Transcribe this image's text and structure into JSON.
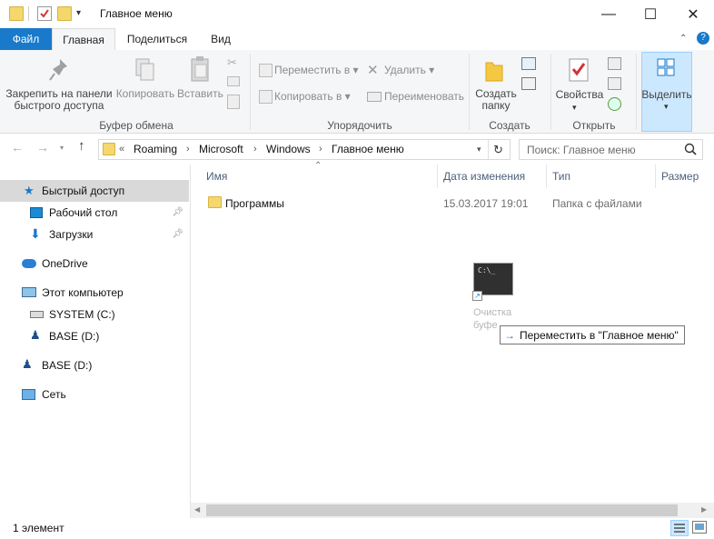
{
  "window": {
    "title": "Главное меню",
    "minimize_glyph": "—",
    "maximize_glyph": "☐",
    "close_glyph": "✕"
  },
  "tabs": [
    {
      "label": "Файл"
    },
    {
      "label": "Главная"
    },
    {
      "label": "Поделиться"
    },
    {
      "label": "Вид"
    }
  ],
  "ribbon": {
    "pin_label_1": "Закрепить на панели",
    "pin_label_2": "быстрого доступа",
    "copy_label": "Копировать",
    "paste_label": "Вставить",
    "clipboard_group": "Буфер обмена",
    "move_to_label": "Переместить в ▾",
    "copy_to_label": "Копировать в ▾",
    "delete_label": "Удалить ▾",
    "rename_label": "Переименовать",
    "organize_group": "Упорядочить",
    "new_folder_1": "Создать",
    "new_folder_2": "папку",
    "new_group": "Создать",
    "properties_label": "Свойства",
    "open_group": "Открыть",
    "select_label": "Выделить"
  },
  "address": {
    "overflow": "«",
    "crumbs": [
      "Roaming",
      "Microsoft",
      "Windows",
      "Главное меню"
    ],
    "search_placeholder": "Поиск: Главное меню"
  },
  "nav": {
    "quick_access": "Быстрый доступ",
    "desktop": "Рабочий стол",
    "downloads": "Загрузки",
    "onedrive": "OneDrive",
    "this_pc": "Этот компьютер",
    "system_c": "SYSTEM (C:)",
    "base_d_sub": "BASE (D:)",
    "base_d": "BASE (D:)",
    "network": "Сеть"
  },
  "columns": {
    "name": "Имя",
    "modified": "Дата изменения",
    "type": "Тип",
    "size": "Размер"
  },
  "files": [
    {
      "name": "Программы",
      "modified": "15.03.2017 19:01",
      "type": "Папка с файлами"
    }
  ],
  "drag": {
    "ghost_label_1": "Очистка",
    "ghost_label_2": "буфе",
    "console_text": "C:\\_",
    "tooltip": "Переместить в \"Главное меню\""
  },
  "status": {
    "count": "1 элемент"
  },
  "colors": {
    "accent": "#1979ca",
    "selection": "#cce8ff",
    "ribbon_bg": "#f5f6f7"
  }
}
